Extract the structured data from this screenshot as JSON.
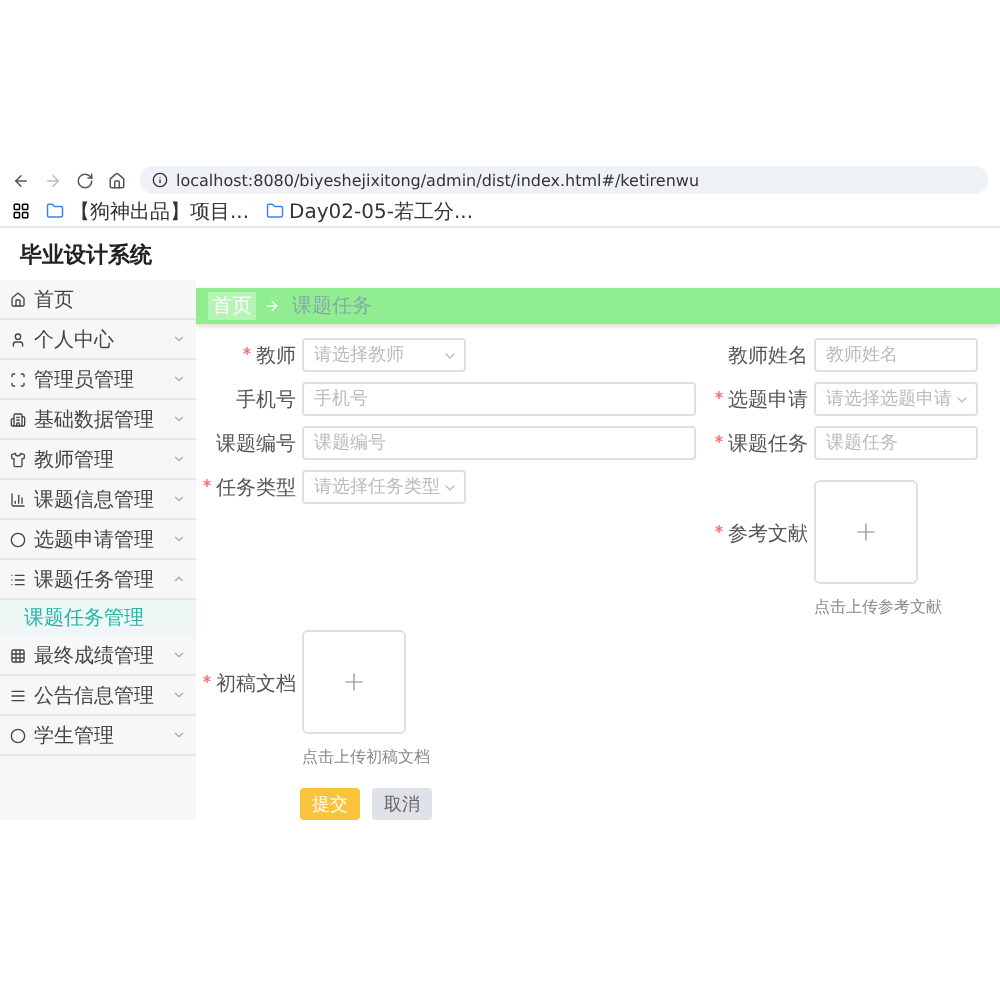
{
  "browser": {
    "url": "localhost:8080/biyeshejixitong/admin/dist/index.html#/ketirenwu",
    "bookmarks": [
      "【狗神出品】项目...",
      "Day02-05-若工分..."
    ]
  },
  "app_title": "毕业设计系统",
  "sidebar": {
    "items": [
      {
        "label": "首页",
        "kind": "link"
      },
      {
        "label": "个人中心",
        "kind": "menu",
        "expanded": false
      },
      {
        "label": "管理员管理",
        "kind": "menu",
        "expanded": false
      },
      {
        "label": "基础数据管理",
        "kind": "menu",
        "expanded": false
      },
      {
        "label": "教师管理",
        "kind": "menu",
        "expanded": false
      },
      {
        "label": "课题信息管理",
        "kind": "menu",
        "expanded": false
      },
      {
        "label": "选题申请管理",
        "kind": "menu",
        "expanded": false
      },
      {
        "label": "课题任务管理",
        "kind": "menu",
        "expanded": true,
        "children": [
          {
            "label": "课题任务管理",
            "selected": true
          }
        ]
      },
      {
        "label": "最终成绩管理",
        "kind": "menu",
        "expanded": false
      },
      {
        "label": "公告信息管理",
        "kind": "menu",
        "expanded": false
      },
      {
        "label": "学生管理",
        "kind": "menu",
        "expanded": false
      }
    ]
  },
  "breadcrumb": [
    "首页",
    "课题任务"
  ],
  "form": {
    "left_fields": [
      {
        "label": "教师",
        "required": true,
        "kind": "select",
        "placeholder": "请选择教师"
      },
      {
        "label": "手机号",
        "required": false,
        "kind": "input",
        "placeholder": "手机号"
      },
      {
        "label": "课题编号",
        "required": false,
        "kind": "input",
        "placeholder": "课题编号"
      },
      {
        "label": "任务类型",
        "required": true,
        "kind": "select",
        "placeholder": "请选择任务类型"
      }
    ],
    "right_fields": [
      {
        "label": "教师姓名",
        "required": false,
        "kind": "input",
        "placeholder": "教师姓名"
      },
      {
        "label": "选题申请",
        "required": true,
        "kind": "select",
        "placeholder": "请选择选题申请"
      },
      {
        "label": "课题任务",
        "required": true,
        "kind": "input",
        "placeholder": "课题任务"
      },
      {
        "label": "参考文献",
        "required": true,
        "kind": "upload",
        "hint": "点击上传参考文献"
      }
    ],
    "bottom_fields": [
      {
        "label": "初稿文档",
        "required": true,
        "kind": "upload",
        "hint": "点击上传初稿文档"
      }
    ],
    "buttons": [
      {
        "label": "提交",
        "kind": "primary"
      },
      {
        "label": "取消",
        "kind": "default"
      }
    ]
  }
}
